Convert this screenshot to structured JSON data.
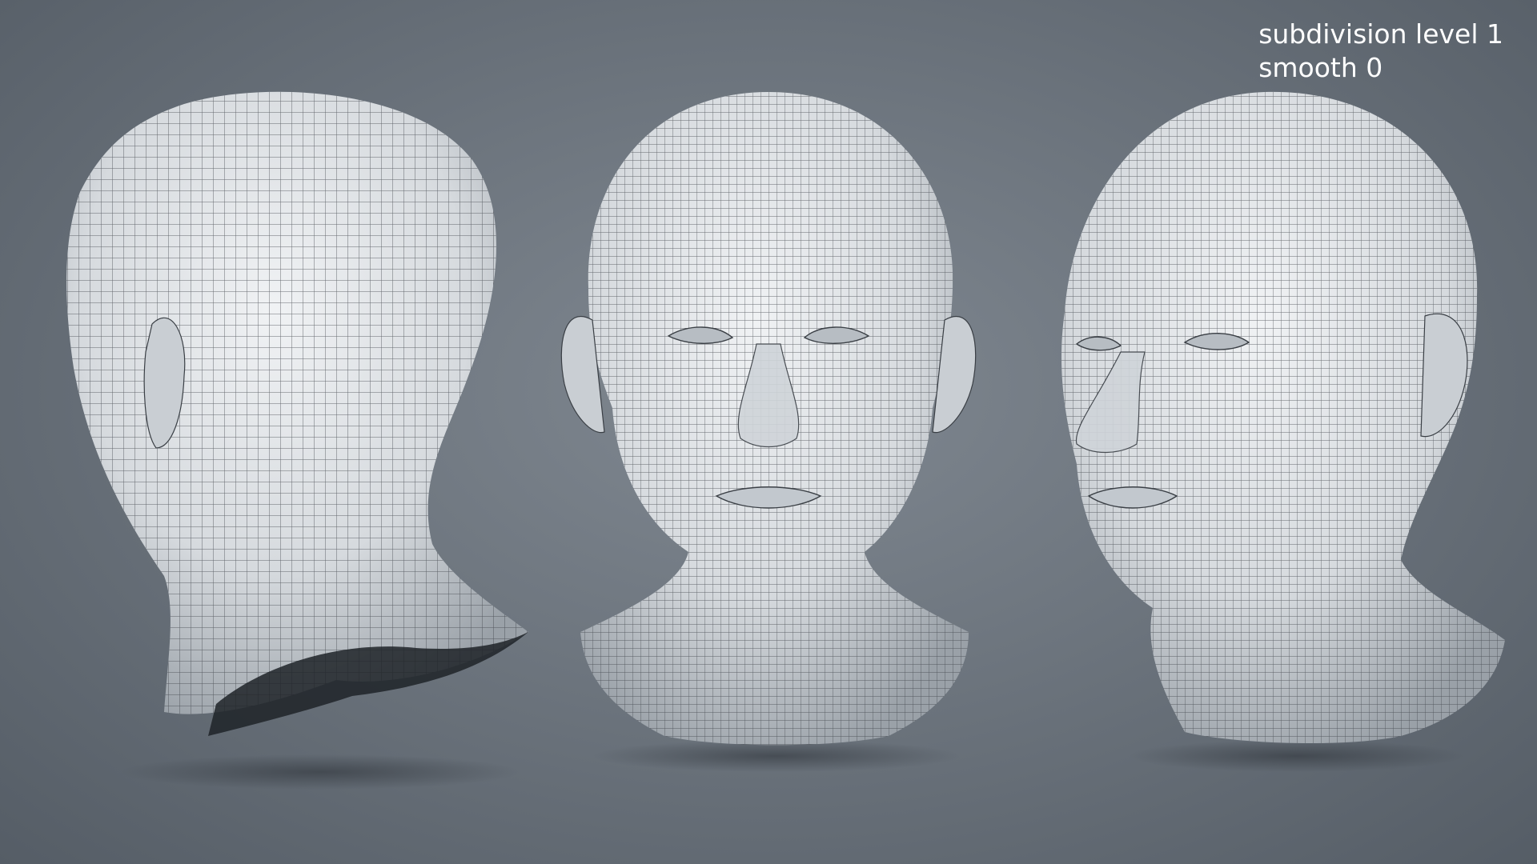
{
  "overlay": {
    "line1": "subdivision level 1",
    "line2": "smooth 0"
  },
  "scene": {
    "background_color": "#6d757e",
    "mesh_color": "#e4e7ea",
    "wire_color": "#3a3f45",
    "views": [
      "back-three-quarter",
      "front",
      "front-three-quarter"
    ]
  }
}
